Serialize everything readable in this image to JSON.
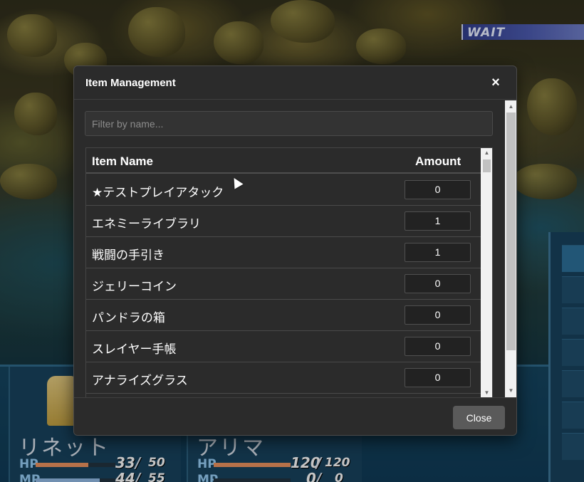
{
  "battle": {
    "wait_label": "WAIT",
    "hp_label": "HP",
    "mp_label": "MP",
    "actors": [
      {
        "name": "リネット",
        "hp": "33",
        "hp_max": "50",
        "mp": "44",
        "mp_max": "55"
      },
      {
        "name": "アリマ",
        "hp": "120",
        "hp_max": "120",
        "mp": "0",
        "mp_max": "0"
      }
    ]
  },
  "modal": {
    "title": "Item Management",
    "close_icon": "×",
    "filter_placeholder": "Filter by name...",
    "filter_value": "",
    "table": {
      "columns": [
        "Item Name",
        "Amount"
      ],
      "rows": [
        {
          "name": "★テストプレイアタック",
          "amount": "0"
        },
        {
          "name": "エネミーライブラリ",
          "amount": "1"
        },
        {
          "name": "戦闘の手引き",
          "amount": "1"
        },
        {
          "name": "ジェリーコイン",
          "amount": "0"
        },
        {
          "name": "パンドラの箱",
          "amount": "0"
        },
        {
          "name": "スレイヤー手帳",
          "amount": "0"
        },
        {
          "name": "アナライズグラス",
          "amount": "0"
        }
      ]
    },
    "footer": {
      "close_label": "Close"
    }
  },
  "colors": {
    "modal_bg": "#2b2b2b",
    "button_bg": "#5a5a5a",
    "hp_gauge": "#e08a5a",
    "mp_gauge": "#8ab0d8"
  }
}
